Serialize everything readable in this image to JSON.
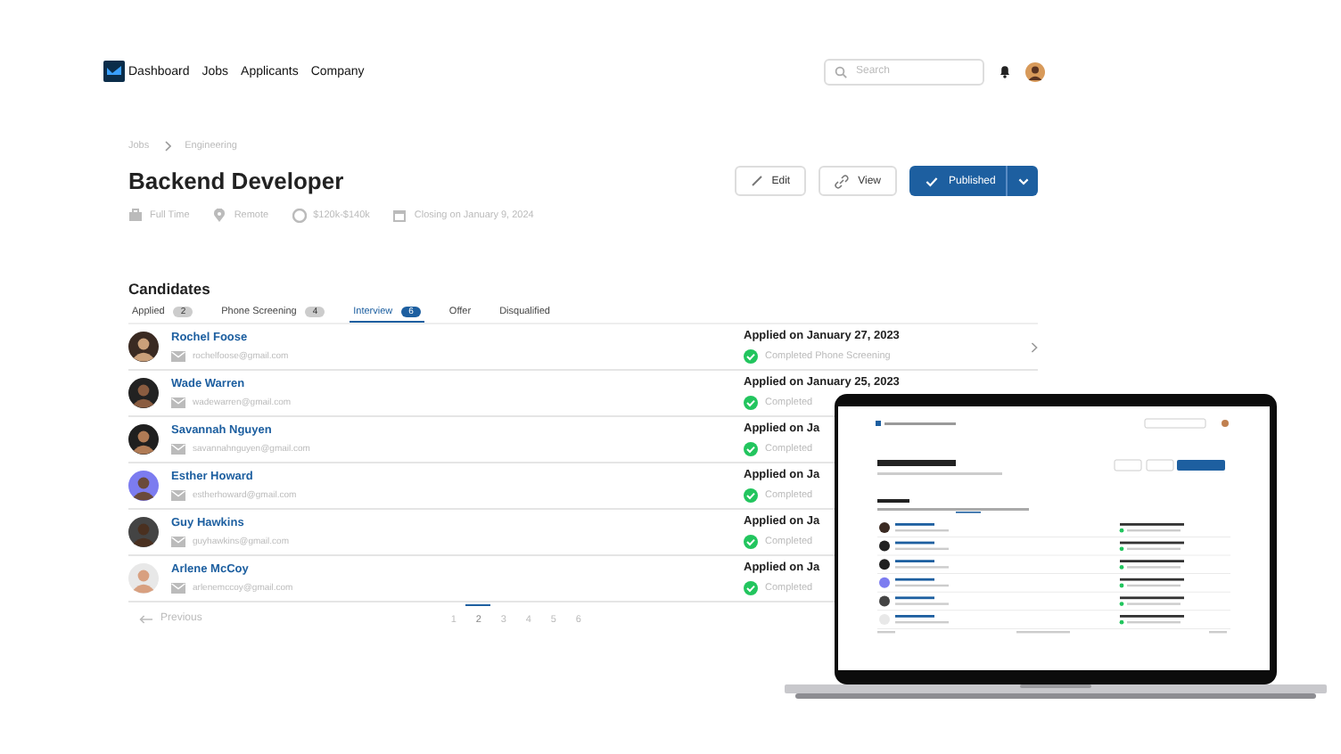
{
  "nav": {
    "links": [
      "Dashboard",
      "Jobs",
      "Applicants",
      "Company"
    ]
  },
  "search": {
    "placeholder": "Search"
  },
  "breadcrumb": [
    "Jobs",
    "Engineering"
  ],
  "job": {
    "title": "Backend Developer",
    "meta": [
      {
        "kind": "type",
        "text": "Full Time"
      },
      {
        "kind": "location",
        "text": "Remote"
      },
      {
        "kind": "salary",
        "text": "$120k-$140k"
      },
      {
        "kind": "date",
        "text": "Closing on January 9, 2024"
      }
    ]
  },
  "actions": [
    {
      "kind": "edit",
      "label": "Edit"
    },
    {
      "kind": "view",
      "label": "View"
    },
    {
      "kind": "publish",
      "label": "Published"
    }
  ],
  "candidates": {
    "title": "Candidates",
    "tabs": [
      {
        "label": "Applied",
        "count": "2",
        "selected": false
      },
      {
        "label": "Phone Screening",
        "count": "4",
        "selected": false
      },
      {
        "label": "Interview",
        "count": "6",
        "selected": true
      },
      {
        "label": "Offer",
        "selected": false
      },
      {
        "label": "Disqualified",
        "selected": false
      }
    ],
    "rows": [
      {
        "name": "Rochel Foose",
        "email": "rochelfoose@gmail.com",
        "applied": "Applied on January 27, 2023",
        "status": "Completed Phone Screening",
        "arrow": true
      },
      {
        "name": "Wade Warren",
        "email": "wadewarren@gmail.com",
        "applied": "Applied on January 25, 2023",
        "status": "Completed",
        "arrow": false
      },
      {
        "name": "Savannah Nguyen",
        "email": "savannahnguyen@gmail.com",
        "applied": "Applied on Ja",
        "status": "Completed",
        "arrow": false
      },
      {
        "name": "Esther Howard",
        "email": "estherhoward@gmail.com",
        "applied": "Applied on Ja",
        "status": "Completed",
        "arrow": false
      },
      {
        "name": "Guy Hawkins",
        "email": "guyhawkins@gmail.com",
        "applied": "Applied on Ja",
        "status": "Completed",
        "arrow": false
      },
      {
        "name": "Arlene McCoy",
        "email": "arlenemccoy@gmail.com",
        "applied": "Applied on Ja",
        "status": "Completed",
        "arrow": false
      }
    ]
  },
  "pagination": {
    "previous": "Previous",
    "pages": [
      {
        "label": "1",
        "selected": false
      },
      {
        "label": "2",
        "selected": true
      },
      {
        "label": "3",
        "selected": false
      },
      {
        "label": "4",
        "selected": false
      },
      {
        "label": "5",
        "selected": false
      },
      {
        "label": "6",
        "selected": false
      }
    ]
  }
}
